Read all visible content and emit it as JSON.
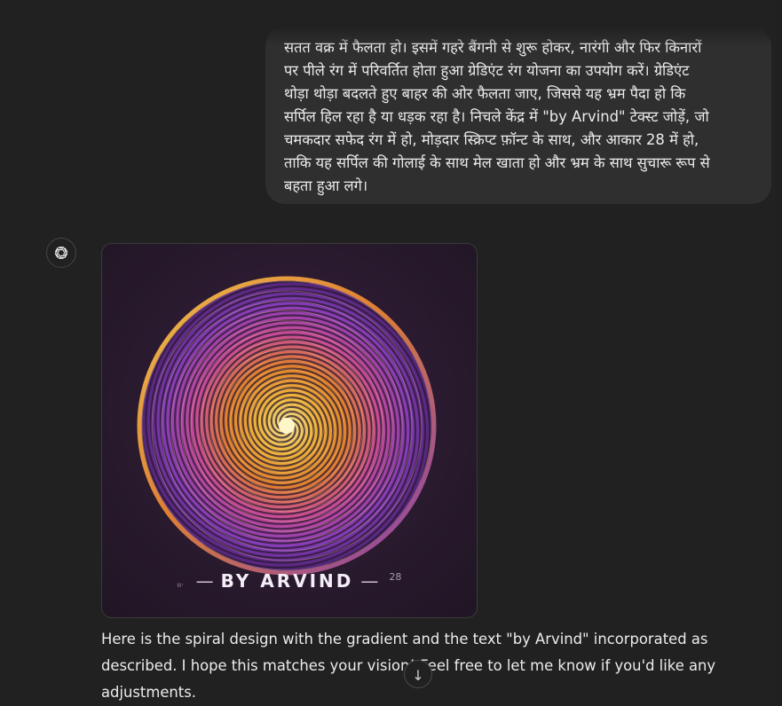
{
  "user_message": {
    "text": "सतत वक्र में फैलता हो। इसमें गहरे बैंगनी से शुरू होकर, नारंगी और फिर किनारों\nपर पीले रंग में परिवर्तित होता हुआ ग्रेडिएंट रंग योजना का उपयोग करें। ग्रेडिएंट\nथोड़ा थोड़ा बदलते हुए बाहर की ओर फैलता जाए, जिससे यह भ्रम पैदा हो कि\nसर्पिल हिल रहा है या धड़क रहा है। निचले केंद्र में \"by Arvind\" टेक्स्ट जोड़ें, जो\nचमकदार सफेद रंग में हो, मोड़दार स्क्रिप्ट फ़ॉन्ट के साथ, और आकार 28 में हो,\nताकि यह सर्पिल की गोलाई के साथ मेल खाता हो और भ्रम के साथ सुचारू रूप से\nबहता हुआ लगे।"
  },
  "assistant": {
    "avatar_icon": "openai-logo-icon",
    "image": {
      "caption_text": "BY ARVIND",
      "caption_number": "28",
      "caption_dash": "—",
      "caption_tick": "ıı·",
      "colors": [
        "#4a1f6e",
        "#8b3fc2",
        "#d44fa0",
        "#f08a2c",
        "#ffc53d",
        "#fff2a0"
      ]
    },
    "message": "Here is the spiral design with the gradient and the text \"by Arvind\" incorporated as described. I hope this matches your vision! Feel free to let me know if you'd like any adjustments."
  },
  "scroll_button": {
    "icon": "arrow-down-icon",
    "glyph": "↓"
  }
}
